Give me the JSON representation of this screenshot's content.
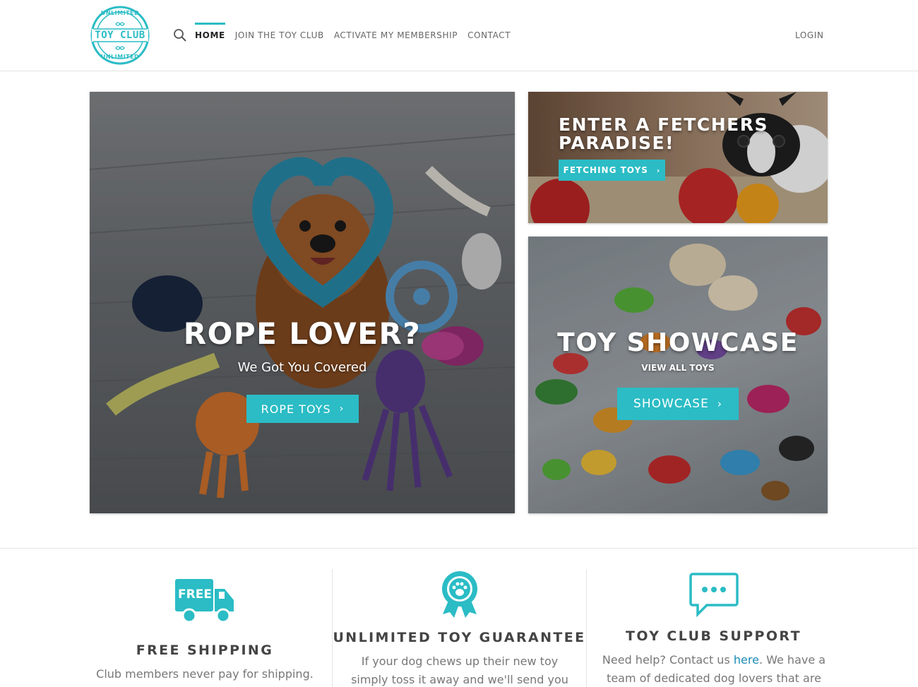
{
  "brand": {
    "logo_top": "UNLIMITED",
    "logo_main": "TOY CLUB",
    "logo_bottom": "UNLIMITED"
  },
  "nav": {
    "items": [
      {
        "label": "HOME",
        "active": true
      },
      {
        "label": "JOIN THE TOY CLUB",
        "active": false
      },
      {
        "label": "ACTIVATE MY MEMBERSHIP",
        "active": false
      },
      {
        "label": "CONTACT",
        "active": false
      }
    ],
    "login": "LOGIN"
  },
  "icons": {
    "search": "search-icon",
    "truck": "free-truck-icon",
    "badge": "paw-award-badge-icon",
    "chat": "chat-bubble-icon"
  },
  "colors": {
    "accent": "#2bbcc5",
    "link": "#1a8ab5"
  },
  "banners": {
    "main": {
      "title": "ROPE LOVER?",
      "subtitle": "We Got You Covered",
      "button": "ROPE TOYS"
    },
    "fetch": {
      "title_line1": "ENTER A FETCHERS",
      "title_line2": "PARADISE!",
      "button": "FETCHING TOYS"
    },
    "showcase": {
      "title": "TOY SHOWCASE",
      "subtitle": "VIEW ALL TOYS",
      "button": "SHOWCASE"
    }
  },
  "features": [
    {
      "title": "FREE SHIPPING",
      "text": "Club members never pay for shipping.",
      "icon_text": "FREE"
    },
    {
      "title": "UNLIMITED TOY GUARANTEE",
      "text": "If your dog chews up their new toy simply toss it away and we'll send you a new toy"
    },
    {
      "title": "TOY CLUB SUPPORT",
      "text_before": "Need help? Contact us ",
      "link": "here",
      "text_after": ". We have a team of dedicated dog lovers that are"
    }
  ]
}
